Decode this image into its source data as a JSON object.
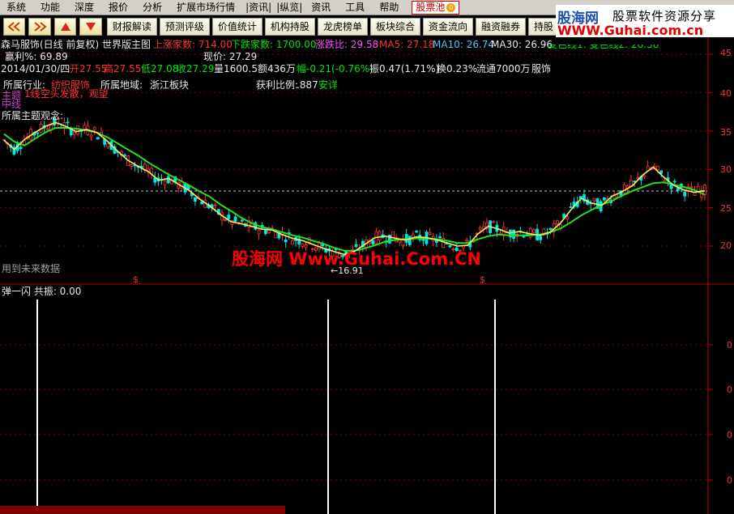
{
  "menu": {
    "items": [
      "系统",
      "功能",
      "深度",
      "报价",
      "分析",
      "扩展市场行情",
      "|资讯|",
      "|纵览|",
      "资讯",
      "工具",
      "帮助"
    ],
    "highlight": "股票池",
    "highlight_badge": "0"
  },
  "toolbar": {
    "nav": [
      "back-double",
      "forward-double",
      "up-arrow",
      "down-arrow"
    ],
    "buttons": [
      "财报解读",
      "预测评级",
      "价值统计",
      "机构持股",
      "龙虎榜单",
      "板块综合",
      "资金流向",
      "融资融券",
      "持股"
    ]
  },
  "logo": {
    "line1": "股海网",
    "line1b": "股票软件资源分享",
    "line2": "WWW.Guhai.com.cn"
  },
  "header": {
    "title": "森马服饰(日线 前复权) 世界版主图",
    "up_count": "上涨家数: 714.00",
    "down_count": "下跌家数: 1700.00",
    "ratio": "涨跌比: 29.58",
    "ma5": "MA5: 27.18",
    "ma10": "MA10: 26.74",
    "ma30": "MA30: 26.96",
    "ma_extra": "变色线1: 变色线2: 28.38",
    "profit": "赢利%: 69.89",
    "current_price": "现价: 27.29"
  },
  "quote": {
    "date": "2014/01/30/四",
    "open": "开27.55",
    "high": "高27.55",
    "low": "低27.08",
    "close": "收27.29",
    "volume": "量1600.5",
    "amount": "额436万",
    "change": "幅-0.21(-0.76%)",
    "amplitude": "振0.47(1.71%)",
    "turnover": "换0.23%",
    "float": "流通7000万",
    "sector": "服饰"
  },
  "info": {
    "industry_label": "所属行业:",
    "industry": "纺织服饰",
    "region_label": "所属地域:",
    "region": "浙江板块",
    "profit_label": "获利比例:",
    "profit_value": ".887",
    "anxiang": "安详",
    "signal": "1线空头发散，观望",
    "overlap_a": "主题",
    "overlap_b": "中线",
    "concept": "所属主题观念:",
    "future_warn": "用到未来数据",
    "low_mark": "←16.91",
    "s_mark": "$"
  },
  "price_axis": {
    "ticks": [
      "45",
      "40",
      "35",
      "30",
      "25",
      "20"
    ]
  },
  "sub_chart": {
    "title": "弹一闪 共振: 0.00",
    "ticks": [
      "0",
      "0",
      "0",
      "0"
    ]
  },
  "watermark": "股海网 Www.Guhai.Com.CN",
  "chart_data": {
    "type": "line",
    "ylim": [
      15,
      47
    ],
    "series": [
      {
        "name": "MA5",
        "values": [
          33.8,
          32.6,
          33.9,
          34.8,
          35.6,
          36.1,
          35.6,
          34.9,
          35.2,
          34.8,
          33.7,
          32.4,
          31.2,
          30.4,
          29.7,
          28.6,
          28.8,
          28.0,
          27.2,
          26.1,
          25.2,
          24.1,
          23.2,
          22.9,
          22.6,
          22.2,
          22.1,
          21.5,
          21.0,
          20.7,
          20.2,
          19.7,
          19.3,
          18.9,
          19.3,
          20.2,
          21.1,
          21.3,
          21.0,
          20.8,
          21.2,
          21.1,
          20.8,
          20.4,
          20.0,
          20.1,
          21.6,
          22.6,
          22.2,
          21.7,
          21.9,
          21.6,
          21.4,
          21.8,
          23.0,
          24.7,
          26.2,
          25.6,
          25.3,
          26.5,
          27.1,
          27.9,
          29.3,
          30.3,
          29.0,
          27.9,
          27.3,
          27.0,
          27.2
        ]
      },
      {
        "name": "MA10",
        "values": [
          34.6,
          33.6,
          33.1,
          34.0,
          34.8,
          35.4,
          35.4,
          35.3,
          35.1,
          34.8,
          34.2,
          33.4,
          32.6,
          31.8,
          30.9,
          30.1,
          29.3,
          28.6,
          27.9,
          27.1,
          26.4,
          25.4,
          24.6,
          23.7,
          23.0,
          22.5,
          22.2,
          21.8,
          21.4,
          21.1,
          20.7,
          20.3,
          19.8,
          19.4,
          19.4,
          19.7,
          20.1,
          20.6,
          20.8,
          20.9,
          21.0,
          21.0,
          20.9,
          20.7,
          20.4,
          20.4,
          20.9,
          21.3,
          21.5,
          21.4,
          21.4,
          21.4,
          21.5,
          21.8,
          22.3,
          23.1,
          24.0,
          24.7,
          25.4,
          25.9,
          26.6,
          27.2,
          27.7,
          28.2,
          28.3,
          28.0,
          27.7,
          27.3,
          26.7
        ]
      }
    ],
    "sub_spikes": [
      46,
      405,
      611
    ]
  }
}
